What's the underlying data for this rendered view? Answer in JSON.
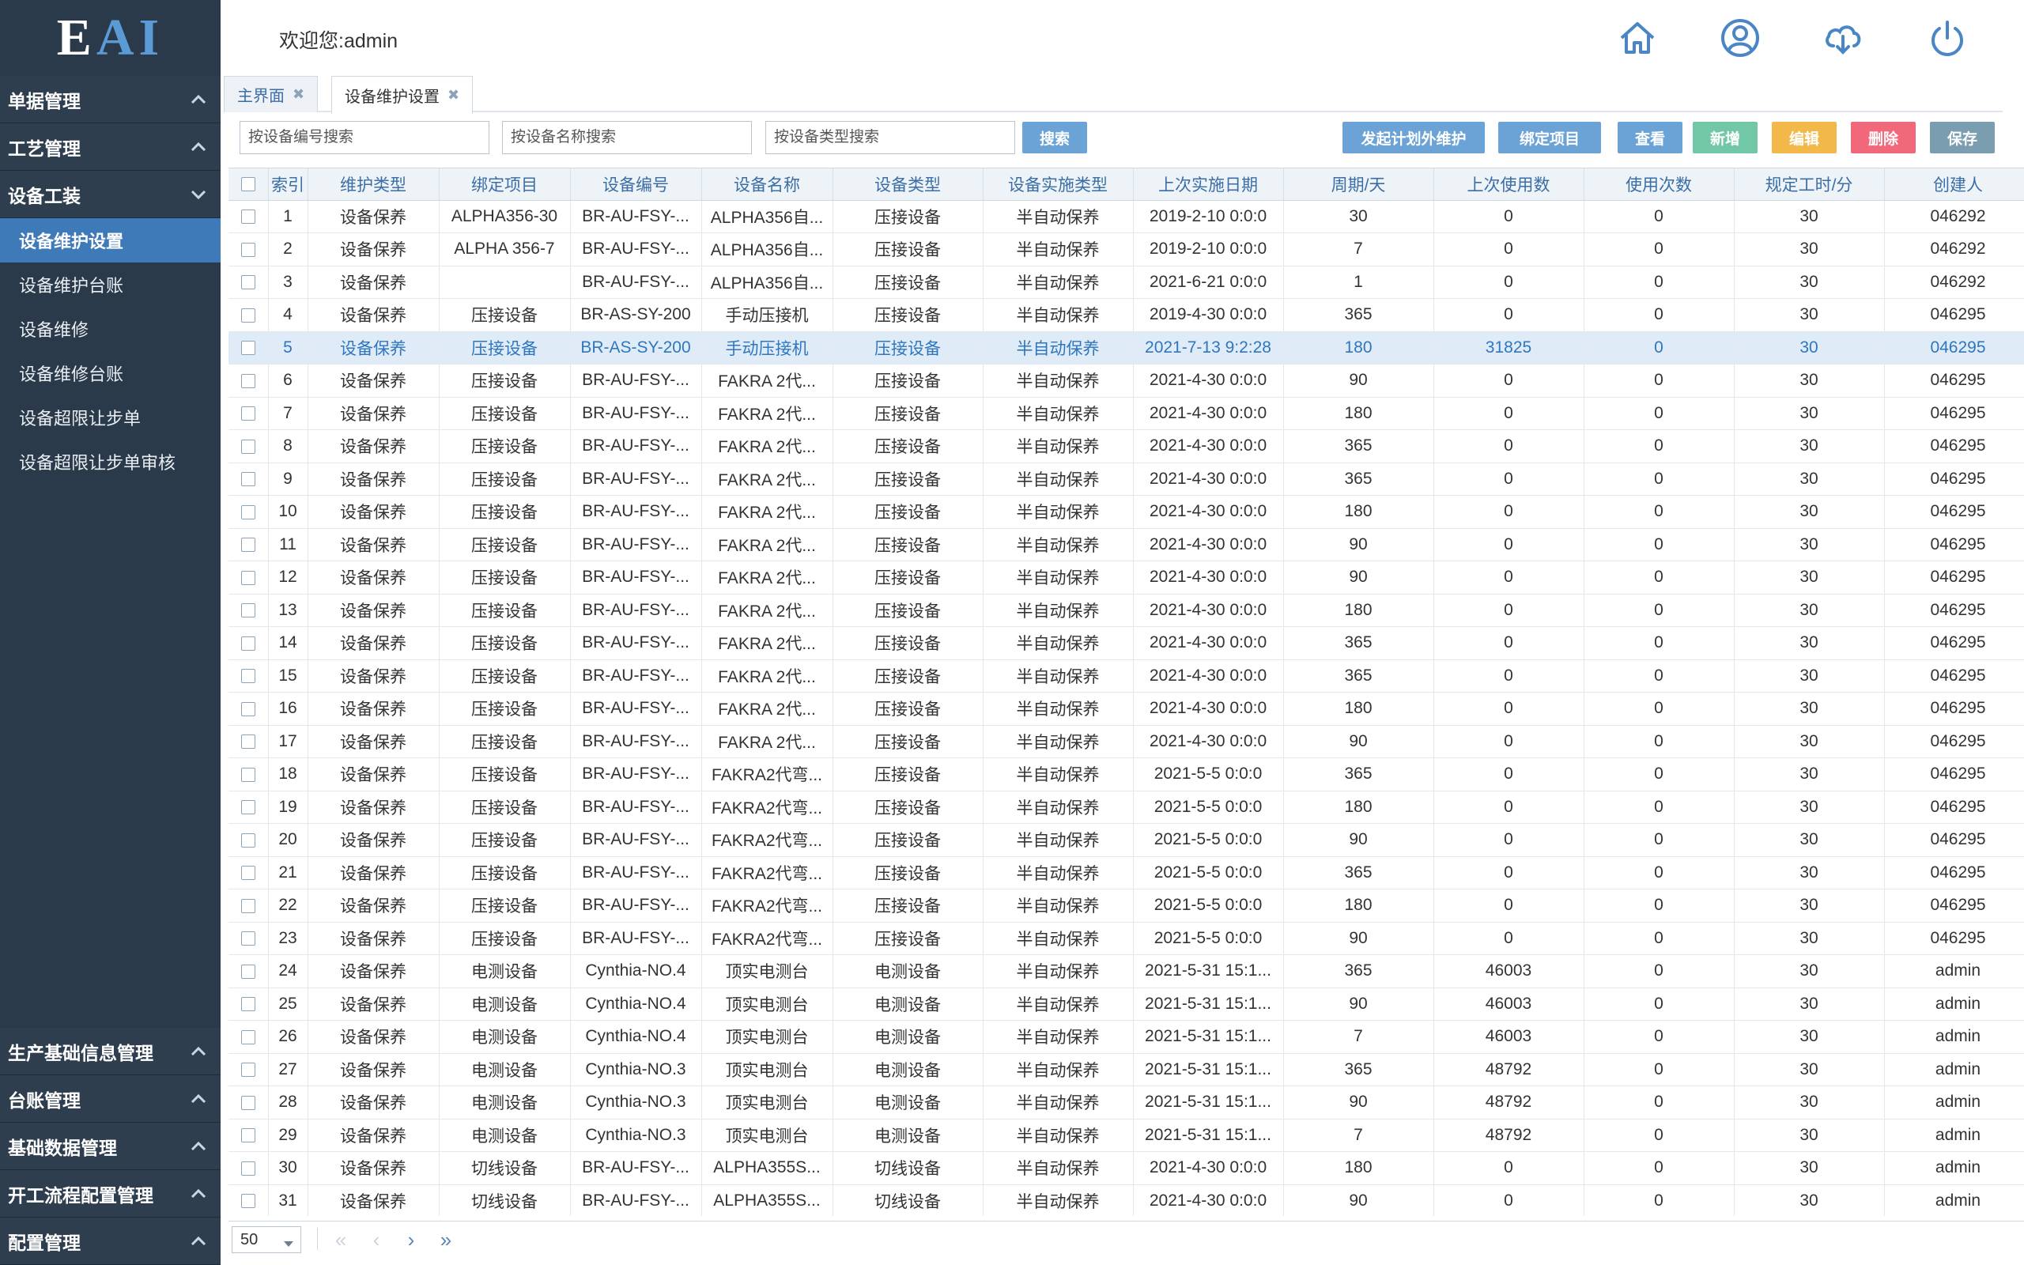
{
  "app": {
    "logo_e": "E",
    "logo_ai": "AI"
  },
  "sidebar": {
    "groups_top": [
      {
        "label": "单据管理",
        "state": "collapsed"
      },
      {
        "label": "工艺管理",
        "state": "collapsed"
      },
      {
        "label": "设备工装",
        "state": "expanded"
      }
    ],
    "submenu": [
      {
        "label": "设备维护设置",
        "active": true
      },
      {
        "label": "设备维护台账",
        "active": false
      },
      {
        "label": "设备维修",
        "active": false
      },
      {
        "label": "设备维修台账",
        "active": false
      },
      {
        "label": "设备超限让步单",
        "active": false
      },
      {
        "label": "设备超限让步单审核",
        "active": false
      }
    ],
    "groups_bottom": [
      {
        "label": "生产基础信息管理"
      },
      {
        "label": "台账管理"
      },
      {
        "label": "基础数据管理"
      },
      {
        "label": "开工流程配置管理"
      },
      {
        "label": "配置管理"
      }
    ]
  },
  "header": {
    "welcome": "欢迎您:admin",
    "icons": [
      "home-icon",
      "user-icon",
      "cloud-download-icon",
      "power-icon"
    ]
  },
  "tabs": [
    {
      "label": "主界面",
      "active": false
    },
    {
      "label": "设备维护设置",
      "active": true
    }
  ],
  "toolbar": {
    "search_code_placeholder": "按设备编号搜索",
    "search_name_placeholder": "按设备名称搜索",
    "search_type_placeholder": "按设备类型搜索",
    "search_btn": "搜索",
    "btn_plan": "发起计划外维护",
    "btn_bind": "绑定项目",
    "btn_view": "查看",
    "btn_add": "新增",
    "btn_edit": "编辑",
    "btn_delete": "删除",
    "btn_save": "保存"
  },
  "table": {
    "headers": [
      "索引",
      "维护类型",
      "绑定项目",
      "设备编号",
      "设备名称",
      "设备类型",
      "设备实施类型",
      "上次实施日期",
      "周期/天",
      "上次使用数",
      "使用次数",
      "规定工时/分",
      "创建人"
    ],
    "selected_row": 5,
    "rows": [
      [
        "1",
        "设备保养",
        "ALPHA356-30",
        "BR-AU-FSY-...",
        "ALPHA356自...",
        "压接设备",
        "半自动保养",
        "2019-2-10 0:0:0",
        "30",
        "0",
        "0",
        "30",
        "046292"
      ],
      [
        "2",
        "设备保养",
        "ALPHA 356-7",
        "BR-AU-FSY-...",
        "ALPHA356自...",
        "压接设备",
        "半自动保养",
        "2019-2-10 0:0:0",
        "7",
        "0",
        "0",
        "30",
        "046292"
      ],
      [
        "3",
        "设备保养",
        "",
        "BR-AU-FSY-...",
        "ALPHA356自...",
        "压接设备",
        "半自动保养",
        "2021-6-21 0:0:0",
        "1",
        "0",
        "0",
        "30",
        "046292"
      ],
      [
        "4",
        "设备保养",
        "压接设备",
        "BR-AS-SY-200",
        "手动压接机",
        "压接设备",
        "半自动保养",
        "2019-4-30 0:0:0",
        "365",
        "0",
        "0",
        "30",
        "046295"
      ],
      [
        "5",
        "设备保养",
        "压接设备",
        "BR-AS-SY-200",
        "手动压接机",
        "压接设备",
        "半自动保养",
        "2021-7-13 9:2:28",
        "180",
        "31825",
        "0",
        "30",
        "046295"
      ],
      [
        "6",
        "设备保养",
        "压接设备",
        "BR-AU-FSY-...",
        "FAKRA 2代...",
        "压接设备",
        "半自动保养",
        "2021-4-30 0:0:0",
        "90",
        "0",
        "0",
        "30",
        "046295"
      ],
      [
        "7",
        "设备保养",
        "压接设备",
        "BR-AU-FSY-...",
        "FAKRA 2代...",
        "压接设备",
        "半自动保养",
        "2021-4-30 0:0:0",
        "180",
        "0",
        "0",
        "30",
        "046295"
      ],
      [
        "8",
        "设备保养",
        "压接设备",
        "BR-AU-FSY-...",
        "FAKRA 2代...",
        "压接设备",
        "半自动保养",
        "2021-4-30 0:0:0",
        "365",
        "0",
        "0",
        "30",
        "046295"
      ],
      [
        "9",
        "设备保养",
        "压接设备",
        "BR-AU-FSY-...",
        "FAKRA 2代...",
        "压接设备",
        "半自动保养",
        "2021-4-30 0:0:0",
        "365",
        "0",
        "0",
        "30",
        "046295"
      ],
      [
        "10",
        "设备保养",
        "压接设备",
        "BR-AU-FSY-...",
        "FAKRA 2代...",
        "压接设备",
        "半自动保养",
        "2021-4-30 0:0:0",
        "180",
        "0",
        "0",
        "30",
        "046295"
      ],
      [
        "11",
        "设备保养",
        "压接设备",
        "BR-AU-FSY-...",
        "FAKRA 2代...",
        "压接设备",
        "半自动保养",
        "2021-4-30 0:0:0",
        "90",
        "0",
        "0",
        "30",
        "046295"
      ],
      [
        "12",
        "设备保养",
        "压接设备",
        "BR-AU-FSY-...",
        "FAKRA 2代...",
        "压接设备",
        "半自动保养",
        "2021-4-30 0:0:0",
        "90",
        "0",
        "0",
        "30",
        "046295"
      ],
      [
        "13",
        "设备保养",
        "压接设备",
        "BR-AU-FSY-...",
        "FAKRA 2代...",
        "压接设备",
        "半自动保养",
        "2021-4-30 0:0:0",
        "180",
        "0",
        "0",
        "30",
        "046295"
      ],
      [
        "14",
        "设备保养",
        "压接设备",
        "BR-AU-FSY-...",
        "FAKRA 2代...",
        "压接设备",
        "半自动保养",
        "2021-4-30 0:0:0",
        "365",
        "0",
        "0",
        "30",
        "046295"
      ],
      [
        "15",
        "设备保养",
        "压接设备",
        "BR-AU-FSY-...",
        "FAKRA 2代...",
        "压接设备",
        "半自动保养",
        "2021-4-30 0:0:0",
        "365",
        "0",
        "0",
        "30",
        "046295"
      ],
      [
        "16",
        "设备保养",
        "压接设备",
        "BR-AU-FSY-...",
        "FAKRA 2代...",
        "压接设备",
        "半自动保养",
        "2021-4-30 0:0:0",
        "180",
        "0",
        "0",
        "30",
        "046295"
      ],
      [
        "17",
        "设备保养",
        "压接设备",
        "BR-AU-FSY-...",
        "FAKRA 2代...",
        "压接设备",
        "半自动保养",
        "2021-4-30 0:0:0",
        "90",
        "0",
        "0",
        "30",
        "046295"
      ],
      [
        "18",
        "设备保养",
        "压接设备",
        "BR-AU-FSY-...",
        "FAKRA2代弯...",
        "压接设备",
        "半自动保养",
        "2021-5-5 0:0:0",
        "365",
        "0",
        "0",
        "30",
        "046295"
      ],
      [
        "19",
        "设备保养",
        "压接设备",
        "BR-AU-FSY-...",
        "FAKRA2代弯...",
        "压接设备",
        "半自动保养",
        "2021-5-5 0:0:0",
        "180",
        "0",
        "0",
        "30",
        "046295"
      ],
      [
        "20",
        "设备保养",
        "压接设备",
        "BR-AU-FSY-...",
        "FAKRA2代弯...",
        "压接设备",
        "半自动保养",
        "2021-5-5 0:0:0",
        "90",
        "0",
        "0",
        "30",
        "046295"
      ],
      [
        "21",
        "设备保养",
        "压接设备",
        "BR-AU-FSY-...",
        "FAKRA2代弯...",
        "压接设备",
        "半自动保养",
        "2021-5-5 0:0:0",
        "365",
        "0",
        "0",
        "30",
        "046295"
      ],
      [
        "22",
        "设备保养",
        "压接设备",
        "BR-AU-FSY-...",
        "FAKRA2代弯...",
        "压接设备",
        "半自动保养",
        "2021-5-5 0:0:0",
        "180",
        "0",
        "0",
        "30",
        "046295"
      ],
      [
        "23",
        "设备保养",
        "压接设备",
        "BR-AU-FSY-...",
        "FAKRA2代弯...",
        "压接设备",
        "半自动保养",
        "2021-5-5 0:0:0",
        "90",
        "0",
        "0",
        "30",
        "046295"
      ],
      [
        "24",
        "设备保养",
        "电测设备",
        "Cynthia-NO.4",
        "顶实电测台",
        "电测设备",
        "半自动保养",
        "2021-5-31 15:1...",
        "365",
        "46003",
        "0",
        "30",
        "admin"
      ],
      [
        "25",
        "设备保养",
        "电测设备",
        "Cynthia-NO.4",
        "顶实电测台",
        "电测设备",
        "半自动保养",
        "2021-5-31 15:1...",
        "90",
        "46003",
        "0",
        "30",
        "admin"
      ],
      [
        "26",
        "设备保养",
        "电测设备",
        "Cynthia-NO.4",
        "顶实电测台",
        "电测设备",
        "半自动保养",
        "2021-5-31 15:1...",
        "7",
        "46003",
        "0",
        "30",
        "admin"
      ],
      [
        "27",
        "设备保养",
        "电测设备",
        "Cynthia-NO.3",
        "顶实电测台",
        "电测设备",
        "半自动保养",
        "2021-5-31 15:1...",
        "365",
        "48792",
        "0",
        "30",
        "admin"
      ],
      [
        "28",
        "设备保养",
        "电测设备",
        "Cynthia-NO.3",
        "顶实电测台",
        "电测设备",
        "半自动保养",
        "2021-5-31 15:1...",
        "90",
        "48792",
        "0",
        "30",
        "admin"
      ],
      [
        "29",
        "设备保养",
        "电测设备",
        "Cynthia-NO.3",
        "顶实电测台",
        "电测设备",
        "半自动保养",
        "2021-5-31 15:1...",
        "7",
        "48792",
        "0",
        "30",
        "admin"
      ],
      [
        "30",
        "设备保养",
        "切线设备",
        "BR-AU-FSY-...",
        "ALPHA355S...",
        "切线设备",
        "半自动保养",
        "2021-4-30 0:0:0",
        "180",
        "0",
        "0",
        "30",
        "admin"
      ],
      [
        "31",
        "设备保养",
        "切线设备",
        "BR-AU-FSY-...",
        "ALPHA355S...",
        "切线设备",
        "半自动保养",
        "2021-4-30 0:0:0",
        "90",
        "0",
        "0",
        "30",
        "admin"
      ]
    ]
  },
  "pager": {
    "page_size": "50",
    "first": "«",
    "prev": "‹",
    "next": "›",
    "last": "»"
  },
  "colors": {
    "sidebar_bg": "#2b3a4a",
    "active_menu": "#3f7ab8",
    "selected_row": "#dfecf8",
    "header_blue": "#3a6ea5"
  }
}
